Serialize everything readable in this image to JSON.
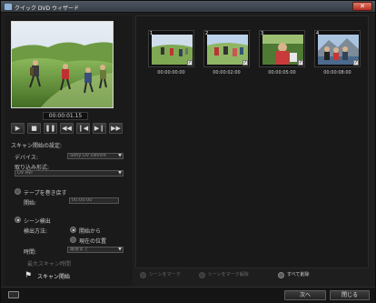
{
  "window": {
    "title": "クイック DVD ウィザード",
    "close_label": "✕"
  },
  "preview": {
    "timecode": "00:00:01.15"
  },
  "transport": {
    "play": "▶",
    "stop": "■",
    "pause": "❚❚",
    "rewind": "◀◀",
    "prev": "❙◀",
    "next": "▶❙",
    "forward": "▶▶"
  },
  "scan_settings": {
    "heading": "スキャン開始の設定:",
    "device_label": "デバイス:",
    "device_value": "Sony DV Device",
    "format_label": "取り込み形式:",
    "format_value": "DV AVI",
    "tape_radio": "テープを巻き戻す",
    "start_label": "開始:",
    "start_value": "00:00:00",
    "scene_radio": "シーン検出",
    "scan_method_label": "検出方法:",
    "option_from_start": "開始から",
    "option_current_pos": "現在の位置",
    "duration_label": "時間:",
    "duration_value": "最後まで",
    "checkbox_label": "最大スキャン時間",
    "scan_button": "スキャン開始"
  },
  "thumbnails": [
    {
      "index": "1",
      "timecode": "00:00:00:00",
      "checked": "✓"
    },
    {
      "index": "2",
      "timecode": "00:00:02:00",
      "checked": "✓"
    },
    {
      "index": "3",
      "timecode": "00:00:05:00",
      "checked": "✓"
    },
    {
      "index": "4",
      "timecode": "00:00:08:00",
      "checked": "✓"
    }
  ],
  "thumb_actions": {
    "mark_scene": "シーンをマーク",
    "unmark_scene": "シーンをマーク解除",
    "select_all": "すべて削除"
  },
  "footer": {
    "next_button": "次へ",
    "close_button": "閉じる"
  },
  "colors": {
    "background": "#1e1e1e",
    "accent": "#4d5661"
  }
}
